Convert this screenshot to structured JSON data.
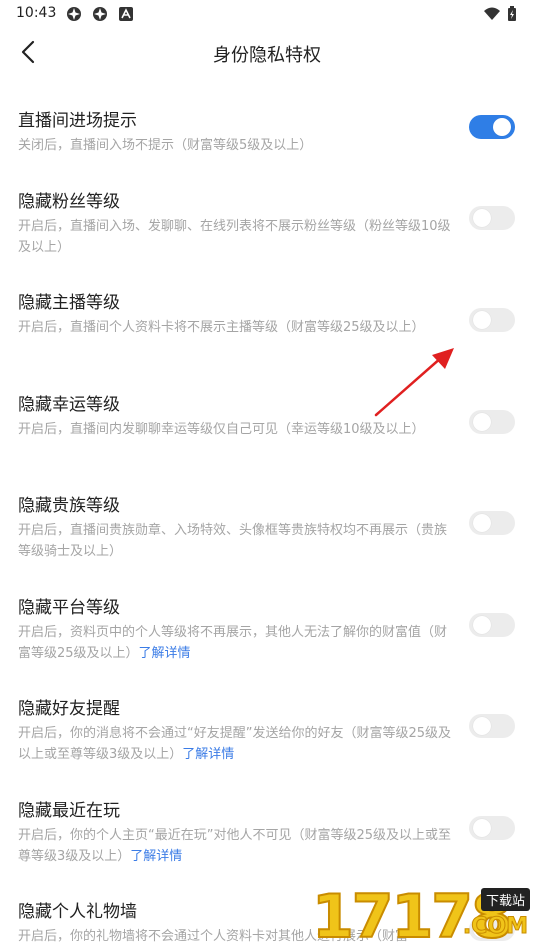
{
  "status_bar": {
    "time": "10:43"
  },
  "header": {
    "title": "身份隐私特权"
  },
  "items": [
    {
      "title": "直播间进场提示",
      "desc": "关闭后，直播间入场不提示（财富等级5级及以上）",
      "link": "",
      "enabled": true
    },
    {
      "title": "隐藏粉丝等级",
      "desc": "开启后，直播间入场、发聊聊、在线列表将不展示粉丝等级（粉丝等级10级及以上）",
      "link": "",
      "enabled": false
    },
    {
      "title": "隐藏主播等级",
      "desc": "开启后，直播间个人资料卡将不展示主播等级（财富等级25级及以上）",
      "link": "",
      "enabled": false
    },
    {
      "title": "隐藏幸运等级",
      "desc": "开启后，直播间内发聊聊幸运等级仅自己可见（幸运等级10级及以上）",
      "link": "",
      "enabled": false
    },
    {
      "title": "隐藏贵族等级",
      "desc": "开启后，直播间贵族勋章、入场特效、头像框等贵族特权均不再展示（贵族等级骑士及以上）",
      "link": "",
      "enabled": false
    },
    {
      "title": "隐藏平台等级",
      "desc": "开启后，资料页中的个人等级将不再展示，其他人无法了解你的财富值（财富等级25级及以上）",
      "link": "了解详情",
      "enabled": false
    },
    {
      "title": "隐藏好友提醒",
      "desc": "开启后，你的消息将不会通过“好友提醒”发送给你的好友（财富等级25级及以上或至尊等级3级及以上）",
      "link": "了解详情",
      "enabled": false
    },
    {
      "title": "隐藏最近在玩",
      "desc": "开启后，你的个人主页“最近在玩”对他人不可见（财富等级25级及以上或至尊等级3级及以上）",
      "link": "了解详情",
      "enabled": false
    },
    {
      "title": "隐藏个人礼物墙",
      "desc": "开启后，你的礼物墙将不会通过个人资料卡对其他人进行展示（财富",
      "link": "",
      "enabled": false
    }
  ],
  "watermark": {
    "number": "17178",
    "tag": "下载站",
    "suffix": ".COM"
  },
  "colors": {
    "accent": "#2f7ee6",
    "toggle_off": "#ececec",
    "annotation_arrow": "#e02020"
  }
}
